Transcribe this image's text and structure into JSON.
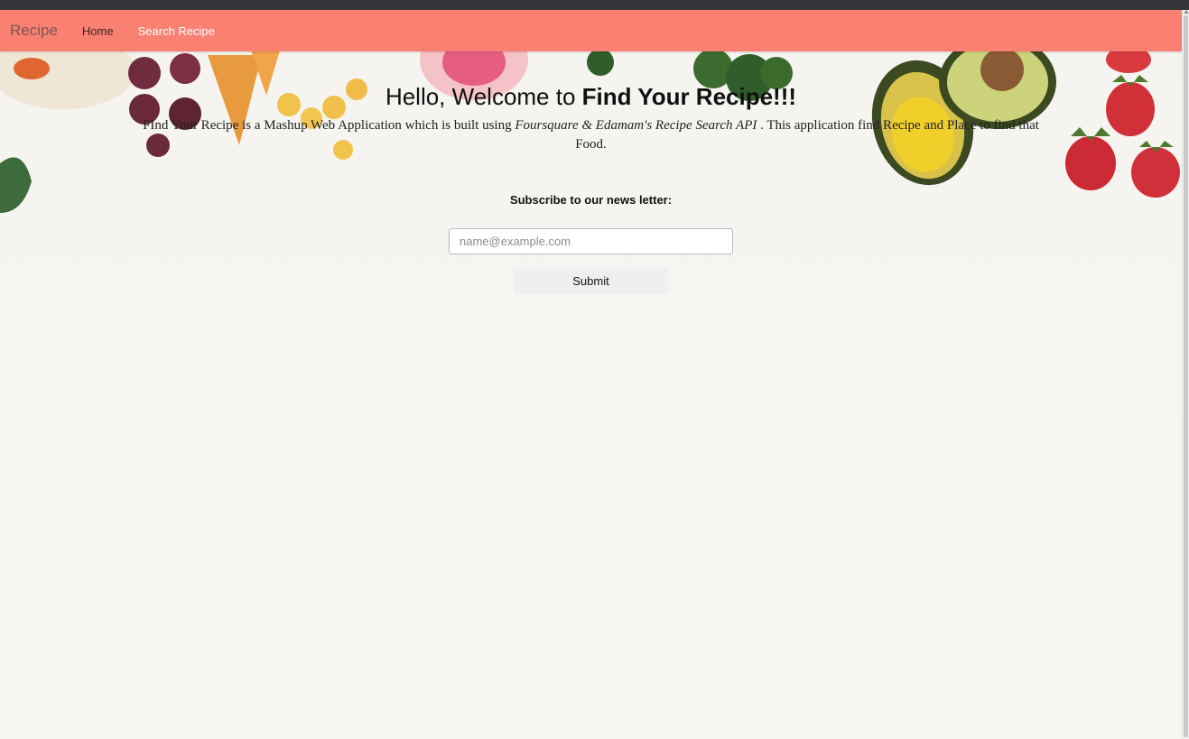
{
  "navbar": {
    "brand": "Recipe",
    "links": [
      {
        "label": "Home"
      },
      {
        "label": "Search Recipe"
      }
    ],
    "background_color": "#fa8072"
  },
  "hero": {
    "heading_prefix": "Hello, Welcome to ",
    "heading_strong": "Find Your Recipe!!!",
    "description_start": "FInd Your Recipe is a Mashup Web Application which is built using ",
    "description_apis": "Foursquare & Edamam's Recipe Search API",
    "description_end": " . This application find Recipe and Place to find that Food."
  },
  "newsletter": {
    "label": "Subscribe to our news letter:",
    "email_placeholder": "name@example.com",
    "email_value": "",
    "submit_label": "Submit"
  }
}
